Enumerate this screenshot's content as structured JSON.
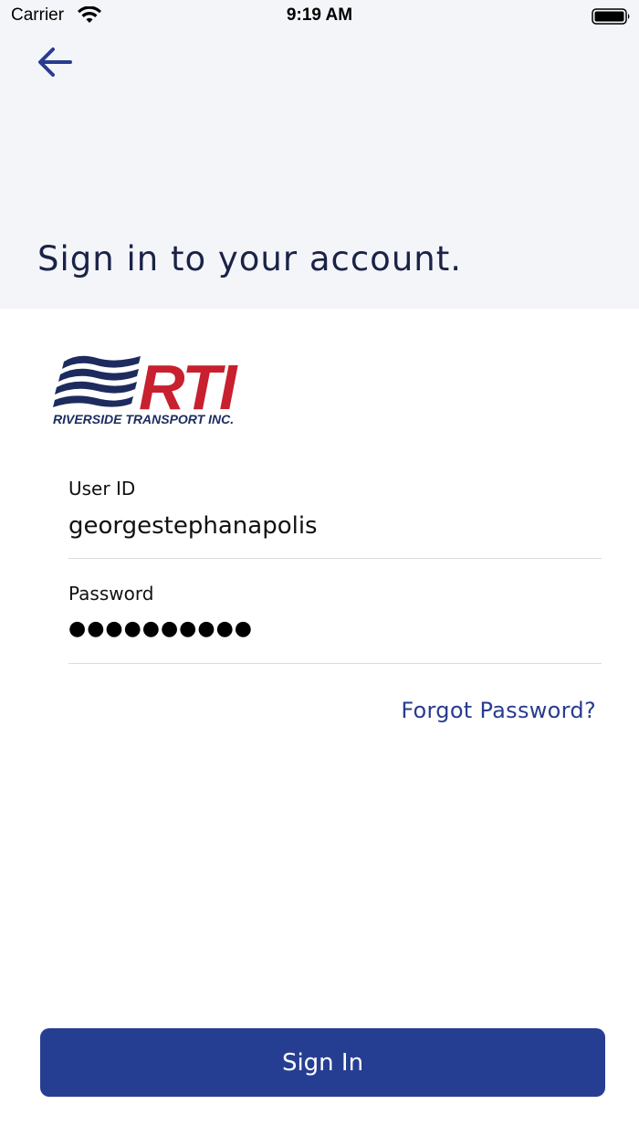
{
  "status_bar": {
    "carrier": "Carrier",
    "time": "9:19 AM"
  },
  "header": {
    "back_icon": "arrow-left-icon",
    "title": "Sign in to your account."
  },
  "logo": {
    "mark": "RTI",
    "company": "RIVERSIDE TRANSPORT INC.",
    "colors": {
      "navy": "#1d2b5e",
      "red": "#c8202f"
    }
  },
  "form": {
    "user_id": {
      "label": "User ID",
      "value": "georgestephanapolis"
    },
    "password": {
      "label": "Password",
      "masked_value": "●●●●●●●●●●"
    },
    "forgot_password": "Forgot Password?"
  },
  "actions": {
    "sign_in": "Sign In"
  },
  "colors": {
    "header_bg": "#f4f5f9",
    "title": "#1a2347",
    "accent": "#283c8e",
    "button_bg": "#263e92"
  }
}
